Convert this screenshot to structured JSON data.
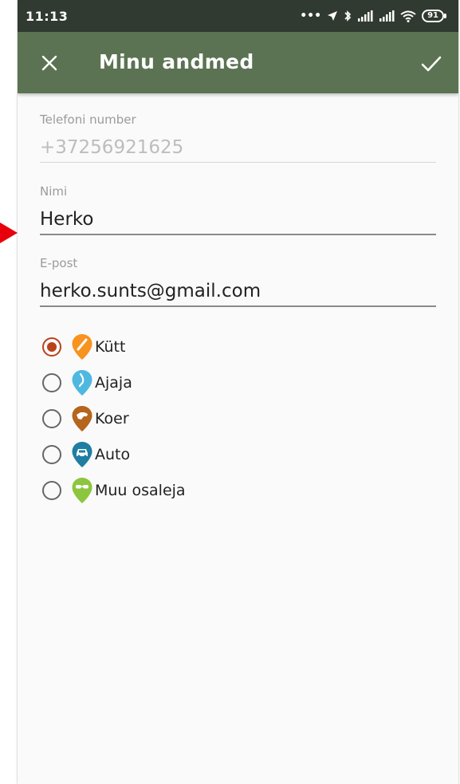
{
  "status_bar": {
    "time": "11:13",
    "battery": "91",
    "icons": [
      "more-dots-icon",
      "location-arrow-icon",
      "bluetooth-icon",
      "signal-icon",
      "signal-icon",
      "wifi-icon",
      "battery-icon"
    ]
  },
  "app_bar": {
    "title": "Minu andmed",
    "close_icon": "close-icon",
    "confirm_icon": "check-icon",
    "color": "#5b7352"
  },
  "form": {
    "phone": {
      "label": "Telefoni number",
      "value": "+37256921625"
    },
    "name": {
      "label": "Nimi",
      "value": "Herko"
    },
    "email": {
      "label": "E-post",
      "value": "herko.sunts@gmail.com"
    }
  },
  "roles": [
    {
      "label": "Kütt",
      "selected": true,
      "color": "#f7931e",
      "icon": "hunter-pin-icon"
    },
    {
      "label": "Ajaja",
      "selected": false,
      "color": "#4fb8e0",
      "icon": "beater-pin-icon"
    },
    {
      "label": "Koer",
      "selected": false,
      "color": "#b5651d",
      "icon": "dog-pin-icon"
    },
    {
      "label": "Auto",
      "selected": false,
      "color": "#1f7ea1",
      "icon": "car-pin-icon"
    },
    {
      "label": "Muu osaleja",
      "selected": false,
      "color": "#8cc63f",
      "icon": "other-pin-icon"
    }
  ]
}
